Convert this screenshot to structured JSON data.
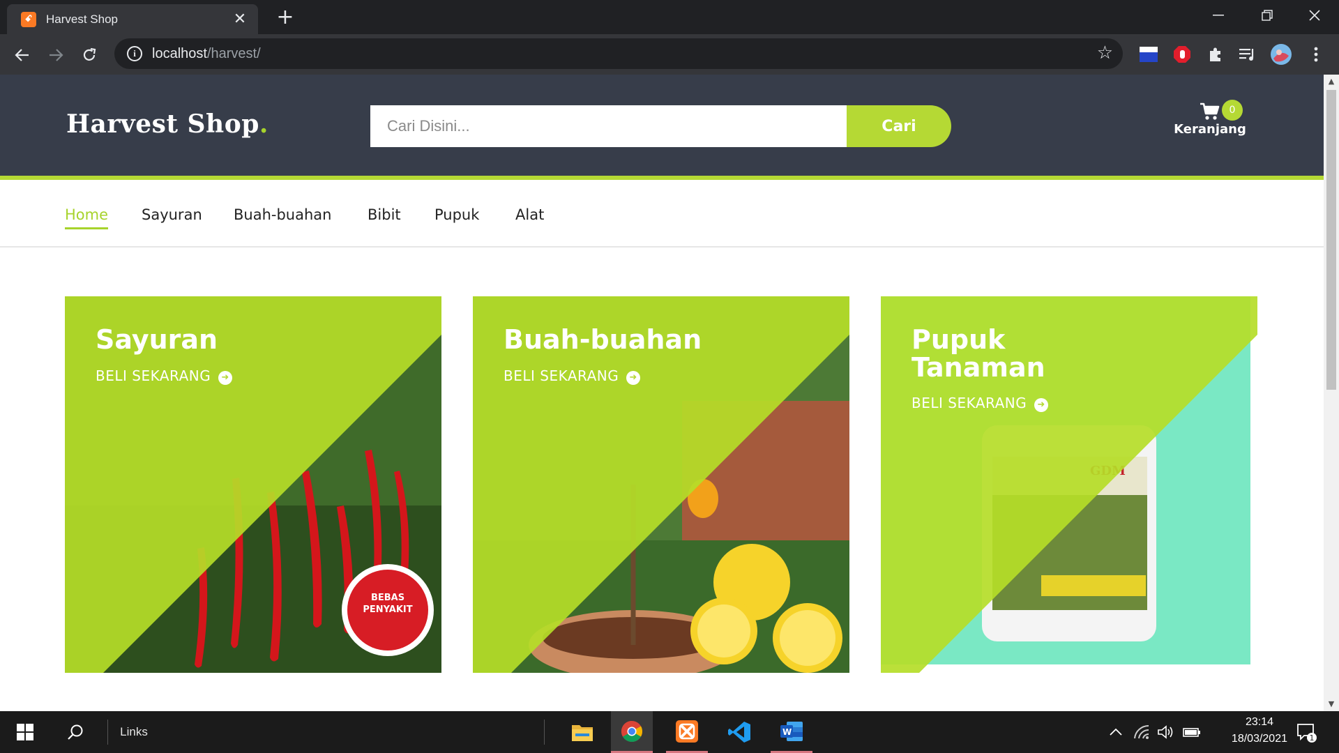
{
  "browser": {
    "tab_title": "Harvest Shop",
    "tab_favicon": "xampp-icon",
    "url_host": "localhost",
    "url_path": "/harvest/"
  },
  "site": {
    "logo_text": "Harvest Shop",
    "logo_dot": ".",
    "search": {
      "placeholder": "Cari Disini...",
      "value": "",
      "button_label": "Cari"
    },
    "cart": {
      "label": "Keranjang",
      "count": "0"
    },
    "menu": [
      {
        "label": "Home",
        "active": true
      },
      {
        "label": "Sayuran",
        "active": false
      },
      {
        "label": "Buah-buahan",
        "active": false
      },
      {
        "label": "Bibit",
        "active": false
      },
      {
        "label": "Pupuk",
        "active": false
      },
      {
        "label": "Alat",
        "active": false
      }
    ],
    "cards": [
      {
        "title": "Sayuran",
        "cta": "BELI SEKARANG",
        "image": "red-chili-plant-photo"
      },
      {
        "title": "Buah-buahan",
        "cta": "BELI SEKARANG",
        "image": "lemon-tree-photo"
      },
      {
        "title": "Pupuk\nTanaman",
        "title_line1": "Pupuk",
        "title_line2": "Tanaman",
        "cta": "BELI SEKARANG",
        "image": "organic-fertilizer-bottle-photo"
      }
    ],
    "accent_color": "#b5d934",
    "header_color": "#373d4a"
  },
  "taskbar": {
    "links_label": "Links",
    "time": "23:14",
    "date": "18/03/2021",
    "notification_count": "1"
  }
}
